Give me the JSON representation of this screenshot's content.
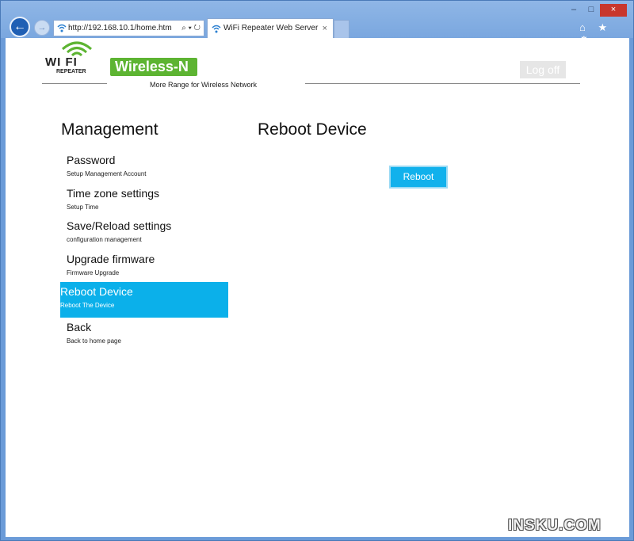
{
  "browser": {
    "url": "http://192.168.10.1/home.htm",
    "tab_title": "WiFi Repeater Web Server",
    "tab_close": "×",
    "address_tools": "⌕ ▾ ↻",
    "window_controls": {
      "minimize": "–",
      "maximize": "□",
      "close": "×"
    },
    "toolbar_icons": "⌂ ★ ⚙"
  },
  "header": {
    "logo_text": "WI FI",
    "logo_sub": "REPEATER",
    "brand": "Wireless-N",
    "tagline": "More Range for Wireless Network",
    "logoff_label": "Log off"
  },
  "sidebar": {
    "title": "Management",
    "items": [
      {
        "label": "Password",
        "sub": "Setup Management Account"
      },
      {
        "label": "Time zone settings",
        "sub": "Setup Time"
      },
      {
        "label": "Save/Reload settings",
        "sub": "configuration management"
      },
      {
        "label": "Upgrade firmware",
        "sub": "Firmware Upgrade"
      },
      {
        "label": "Reboot Device",
        "sub": "Reboot The Device",
        "active": true
      },
      {
        "label": "Back",
        "sub": "Back to home page"
      }
    ]
  },
  "main": {
    "title": "Reboot Device",
    "reboot_label": "Reboot"
  },
  "watermark": "INSKU.COM",
  "colors": {
    "accent": "#0bb0ea",
    "brand_green": "#5db432",
    "browser_blue": "#6b9bd8"
  }
}
